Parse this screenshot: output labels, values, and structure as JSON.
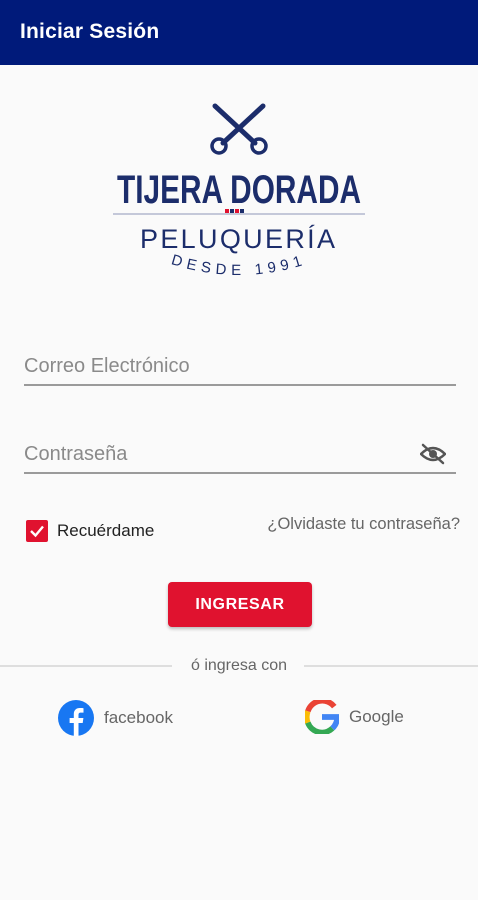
{
  "appbar": {
    "title": "Iniciar Sesión"
  },
  "logo": {
    "name": "TIJERA DORADA",
    "subtitle": "PELUQUERÍA",
    "tagline": "DESDE 1991",
    "icon": "scissors-icon",
    "color": "#1c2d6b"
  },
  "form": {
    "email_placeholder": "Correo Electrónico",
    "password_placeholder": "Contraseña",
    "remember_label": "Recuérdame",
    "remember_checked": true,
    "forgot_link": "¿Olvidaste tu contraseña?",
    "submit_label": "INGRESAR"
  },
  "social": {
    "divider_text": "ó ingresa con",
    "facebook_label": "facebook",
    "google_label": "Google"
  },
  "colors": {
    "appbar": "#001a7a",
    "accent": "#e0122f",
    "facebook": "#1877f2"
  }
}
